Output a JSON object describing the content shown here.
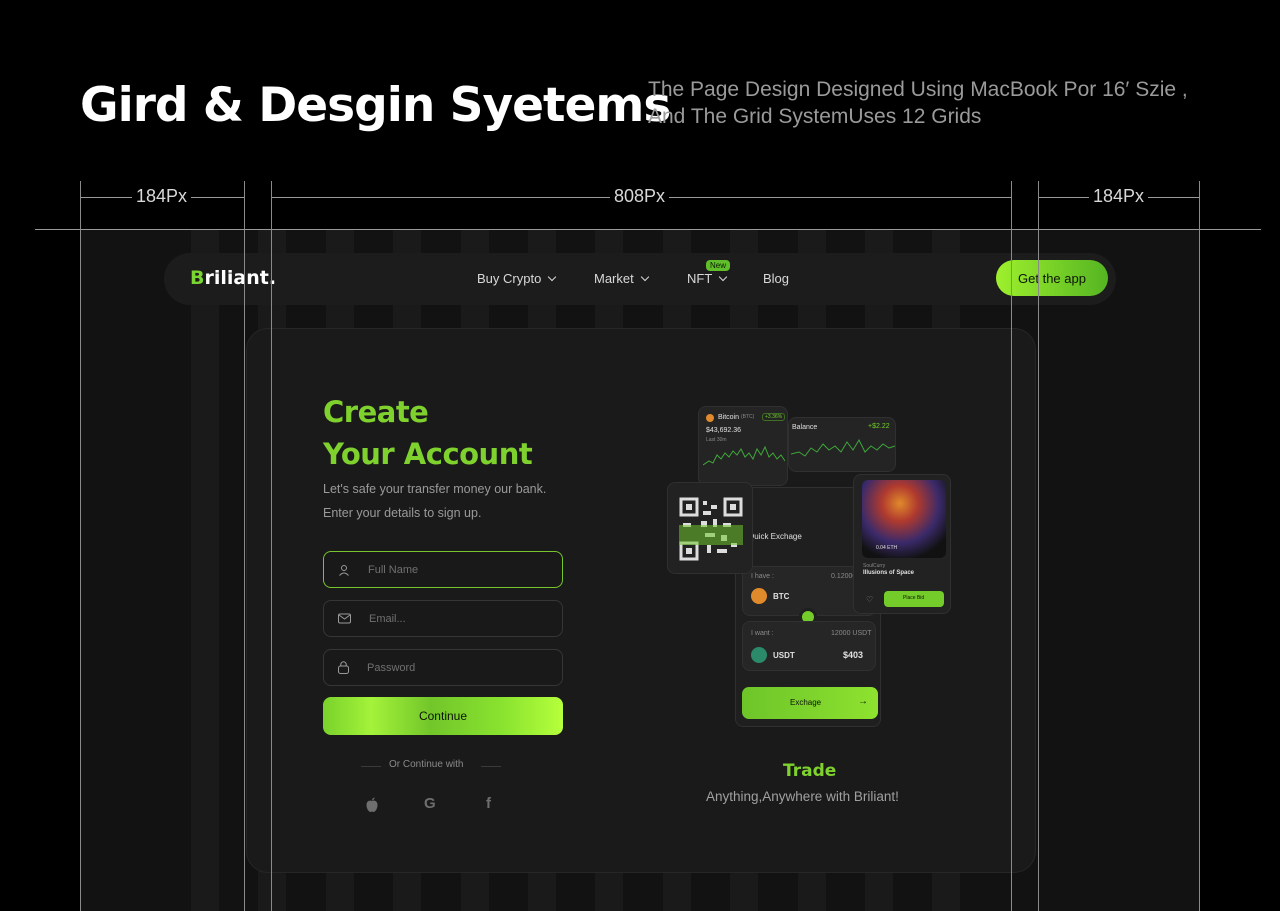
{
  "header": {
    "title": "Gird & Desgin Syetems",
    "subtitle_line1": "The Page Design Designed Using MacBook Por 16′ Szie ,",
    "subtitle_line2": "And The Grid SystemUses 12 Grids"
  },
  "measures": {
    "left": "184Px",
    "center": "808Px",
    "right": "184Px"
  },
  "nav": {
    "logo_initial": "B",
    "logo_rest": "riliant.",
    "items": [
      "Buy Crypto",
      "Market",
      "NFT",
      "Blog"
    ],
    "new_badge": "New",
    "cta": "Get the app"
  },
  "signup": {
    "title_line1": "Create",
    "title_line2": "Your Account",
    "desc_line1": "Let's safe your transfer money our bank.",
    "desc_line2": "Enter your details to sign up.",
    "fullname_placeholder": "Full Name",
    "email_placeholder": "Email...",
    "password_placeholder": "Password",
    "continue": "Continue",
    "or_continue": "Or Continue with"
  },
  "mock": {
    "bitcoin_name": "Bitcoin",
    "bitcoin_ticker": "(BTC)",
    "bitcoin_change": "+3.36%",
    "bitcoin_price": "$43,692.36",
    "bitcoin_sub": "Last 30m",
    "balance": "Balance",
    "balance_change": "+$2.22",
    "quick_exchange": "Quick Exchage",
    "i_have": "I have :",
    "have_amount": "0.12000",
    "btc": "BTC",
    "i_want": "I want :",
    "want_amount": "12000 USDT",
    "usdt": "USDT",
    "usdt_value": "$403",
    "exchange_btn": "Exchage",
    "nft_eth": "0.04 ETH",
    "nft_creator": "SoulCurry",
    "nft_title": "Illusions of Space",
    "place_bid": "Place Bid"
  },
  "trade": {
    "title": "Trade",
    "subtitle": "Anything,Anywhere with Briliant!"
  },
  "colors": {
    "accent": "#7fd22e",
    "background": "#000000",
    "card": "#1a1a1a"
  }
}
